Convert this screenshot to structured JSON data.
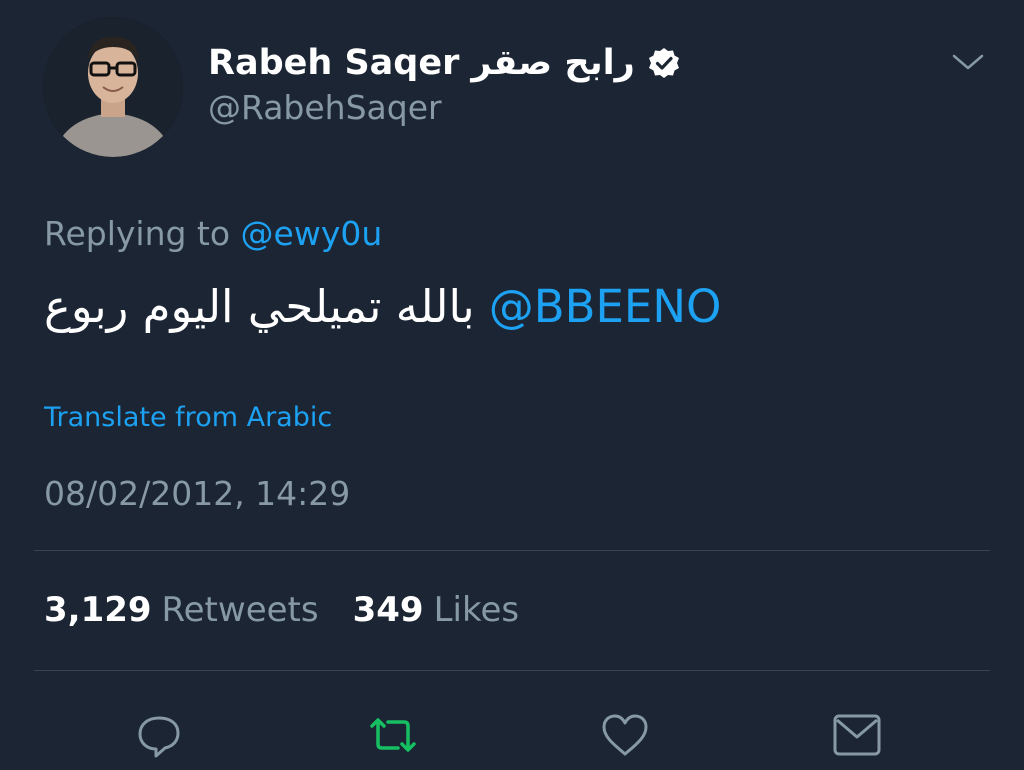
{
  "tweet": {
    "display_name_latin": "Rabeh Saqer",
    "display_name_arabic": "رابح صقر",
    "handle": "@RabehSaqer",
    "replying_prefix": "Replying to",
    "replying_mention": "@ewy0u",
    "mention": "@BBEENO",
    "text_arabic": "بالله تميلحي اليوم ربوع",
    "translate_label": "Translate from Arabic",
    "timestamp": "08/02/2012, 14:29",
    "retweets_count": "3,129",
    "retweets_label": "Retweets",
    "likes_count": "349",
    "likes_label": "Likes"
  },
  "icons": {
    "verified": "verified-badge-icon",
    "chevron": "chevron-down-icon",
    "reply": "reply-icon",
    "retweet": "retweet-icon",
    "like": "heart-icon",
    "message": "envelope-icon"
  },
  "colors": {
    "background": "#1b2533",
    "accent": "#1da1f2",
    "muted": "#8899a6",
    "retweet_active": "#17bf63",
    "divider": "#38444d"
  }
}
